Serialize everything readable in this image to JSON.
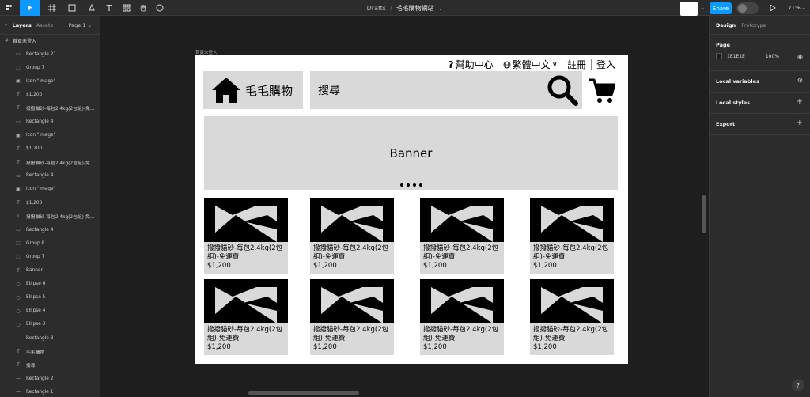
{
  "toolbar": {
    "breadcrumb_root": "Drafts",
    "separator": "/",
    "file_name": "毛毛購物網站",
    "share_label": "Share",
    "zoom": "71%"
  },
  "left_panel": {
    "tab_layers": "Layers",
    "tab_assets": "Assets",
    "page_selector": "Page 1",
    "page_name": "首頁未登入",
    "layers": [
      {
        "icon": "rect",
        "label": "Rectangle 21"
      },
      {
        "icon": "group",
        "label": "Group 7"
      },
      {
        "icon": "image",
        "label": "icon \"image\""
      },
      {
        "icon": "text",
        "label": "$1,200"
      },
      {
        "icon": "text",
        "label": "撥撥貓砂-每包2.4kg(2包組)-免..."
      },
      {
        "icon": "rect",
        "label": "Rectangle 4"
      },
      {
        "icon": "image",
        "label": "icon \"image\""
      },
      {
        "icon": "text",
        "label": "$1,200"
      },
      {
        "icon": "text",
        "label": "撥撥貓砂-每包2.4kg(2包組)-免..."
      },
      {
        "icon": "rect",
        "label": "Rectangle 4"
      },
      {
        "icon": "image",
        "label": "icon \"image\""
      },
      {
        "icon": "text",
        "label": "$1,200"
      },
      {
        "icon": "text",
        "label": "撥撥貓砂-每包2.4kg(2包組)-免..."
      },
      {
        "icon": "rect",
        "label": "Rectangle 4"
      },
      {
        "icon": "group",
        "label": "Group 8"
      },
      {
        "icon": "group",
        "label": "Group 7"
      },
      {
        "icon": "text",
        "label": "Banner"
      },
      {
        "icon": "ellipse",
        "label": "Ellipse 6"
      },
      {
        "icon": "ellipse",
        "label": "Ellipse 5"
      },
      {
        "icon": "ellipse",
        "label": "Ellipse 4"
      },
      {
        "icon": "ellipse",
        "label": "Ellipse 3"
      },
      {
        "icon": "line",
        "label": "Rectangle 3"
      },
      {
        "icon": "text",
        "label": "毛毛購物"
      },
      {
        "icon": "text",
        "label": "搜尋"
      },
      {
        "icon": "line",
        "label": "Rectangle 2"
      },
      {
        "icon": "line",
        "label": "Rectangle 1"
      }
    ]
  },
  "right_panel": {
    "tab_design": "Design",
    "tab_prototype": "Prototype",
    "page_heading": "Page",
    "page_color": "1E1E1E",
    "page_opacity": "100%",
    "local_variables": "Local variables",
    "local_styles": "Local styles",
    "export": "Export",
    "help": "?"
  },
  "frame": {
    "label": "首頁未登入",
    "nav": {
      "help_icon": "?",
      "help": "幫助中心",
      "lang": "繁體中文",
      "register": "註冊",
      "login": "登入"
    },
    "logo_text": "毛毛購物",
    "search_placeholder": "搜尋",
    "banner_text": "Banner",
    "products": [
      {
        "name": "撥撥貓砂-每包2.4kg(2包組)-免運費",
        "price": "$1,200"
      },
      {
        "name": "撥撥貓砂-每包2.4kg(2包組)-免運費",
        "price": "$1,200"
      },
      {
        "name": "撥撥貓砂-每包2.4kg(2包組)-免運費",
        "price": "$1,200"
      },
      {
        "name": "撥撥貓砂-每包2.4kg(2包組)-免運費",
        "price": "$1,200"
      },
      {
        "name": "撥撥貓砂-每包2.4kg(2包組)-免運費",
        "price": "$1,200"
      },
      {
        "name": "撥撥貓砂-每包2.4kg(2包組)-免運費",
        "price": "$1,200"
      },
      {
        "name": "撥撥貓砂-每包2.4kg(2包組)-免運費",
        "price": "$1,200"
      },
      {
        "name": "撥撥貓砂-每包2.4kg(2包組)-免運費",
        "price": "$1,200"
      }
    ]
  },
  "colors": {
    "accent": "#0d99ff",
    "canvas_bg": "#1e1e1e",
    "panel_bg": "#2c2c2c",
    "placeholder_gray": "#d9d9d9"
  }
}
